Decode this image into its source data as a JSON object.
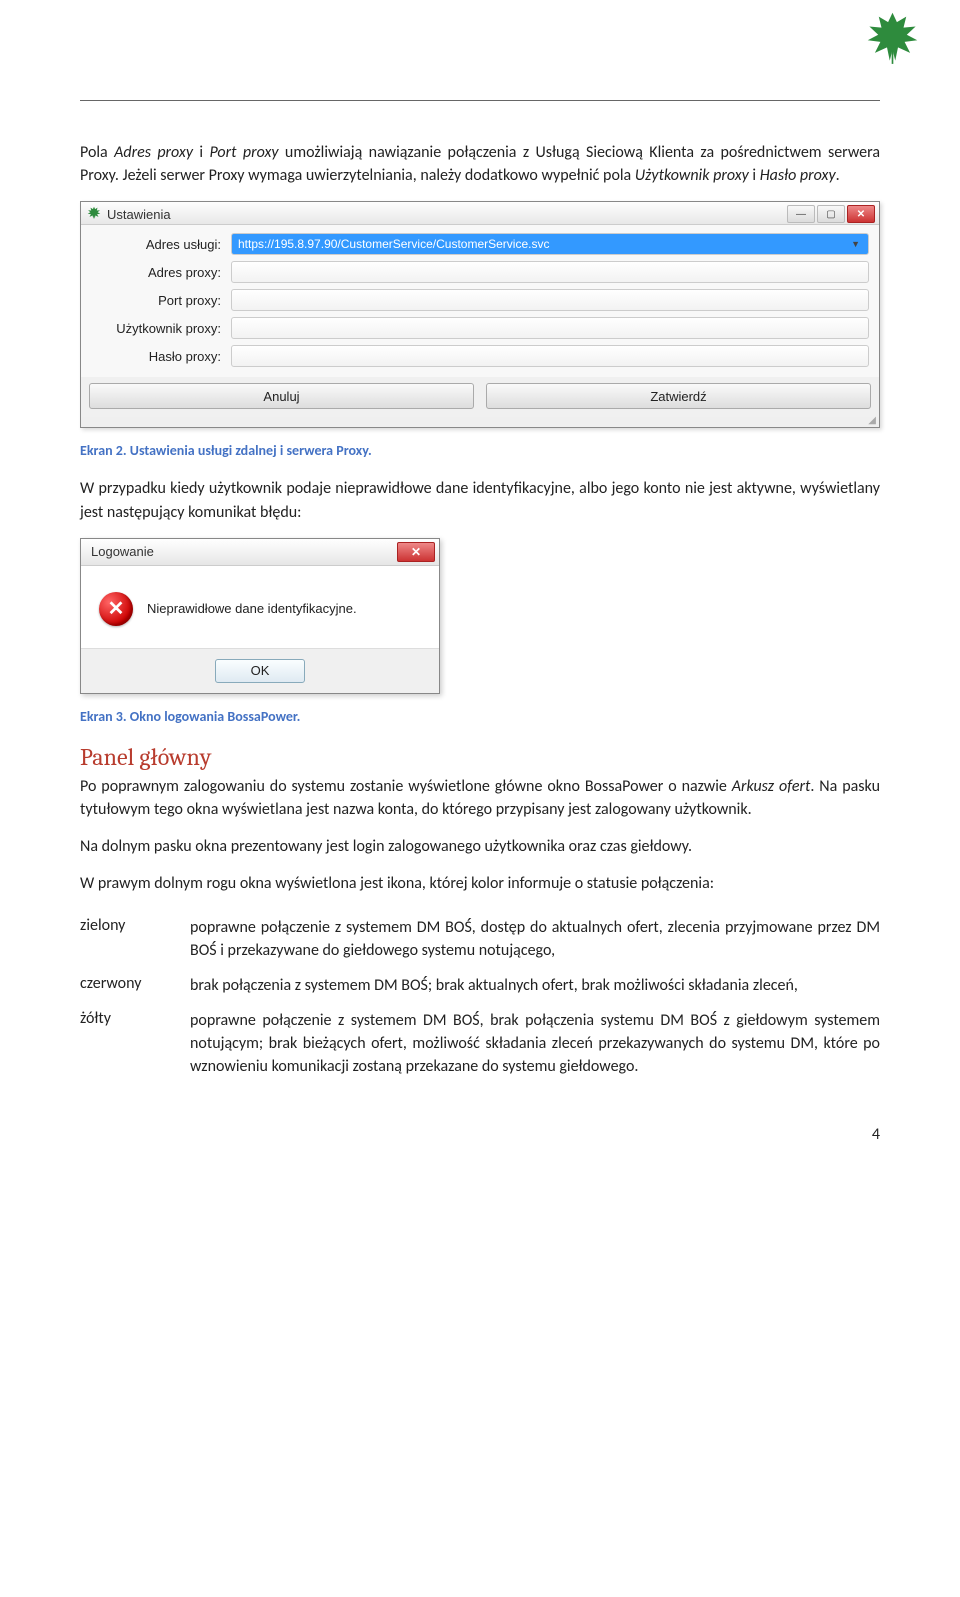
{
  "intro": {
    "p1_a": "Pola ",
    "p1_i1": "Adres proxy",
    "p1_b": " i ",
    "p1_i2": "Port proxy",
    "p1_c": " umożliwiają nawiązanie połączenia z Usługą Sieciową Klienta za pośrednictwem serwera Proxy. Jeżeli serwer Proxy wymaga uwierzytelniania, należy dodatkowo wypełnić pola ",
    "p1_i3": "Użytkownik proxy",
    "p1_d": " i ",
    "p1_i4": "Hasło proxy",
    "p1_e": "."
  },
  "settings": {
    "title": "Ustawienia",
    "fields": [
      {
        "label": "Adres usługi:",
        "value": "https://195.8.97.90/CustomerService/CustomerService.svc",
        "selected": true,
        "dropdown": true
      },
      {
        "label": "Adres proxy:",
        "value": ""
      },
      {
        "label": "Port proxy:",
        "value": ""
      },
      {
        "label": "Użytkownik proxy:",
        "value": ""
      },
      {
        "label": "Hasło proxy:",
        "value": ""
      }
    ],
    "cancel": "Anuluj",
    "confirm": "Zatwierdź"
  },
  "caption1": "Ekran 2. Ustawienia usługi zdalnej i serwera Proxy.",
  "p2": "W przypadku kiedy użytkownik podaje nieprawidłowe dane identyfikacyjne, albo jego konto nie jest aktywne, wyświetlany jest następujący komunikat błędu:",
  "dialog": {
    "title": "Logowanie",
    "message": "Nieprawidłowe dane identyfikacyjne.",
    "ok": "OK"
  },
  "caption2": "Ekran 3. Okno logowania BossaPower.",
  "heading": "Panel główny",
  "p3_a": "Po poprawnym zalogowaniu do systemu zostanie wyświetlone główne okno BossaPower o nazwie ",
  "p3_i": "Arkusz ofert",
  "p3_b": ". Na pasku tytułowym tego okna wyświetlana jest nazwa konta, do którego przypisany jest zalogowany użytkownik.",
  "p4": "Na dolnym pasku okna prezentowany jest login zalogowanego użytkownika oraz czas giełdowy.",
  "p5": "W prawym dolnym rogu okna wyświetlona jest ikona, której kolor informuje o statusie połączenia:",
  "statuses": [
    {
      "key": "zielony",
      "val": "poprawne połączenie z systemem DM BOŚ, dostęp do aktualnych ofert, zlecenia przyjmowane przez DM BOŚ i przekazywane do giełdowego systemu notującego,"
    },
    {
      "key": "czerwony",
      "val": "brak połączenia z systemem DM BOŚ; brak aktualnych ofert, brak możliwości składania zleceń,"
    },
    {
      "key": "żółty",
      "val": "poprawne połączenie z systemem DM BOŚ, brak połączenia systemu DM BOŚ z giełdowym systemem notującym; brak bieżących ofert, możliwość składania zleceń przekazywanych do systemu DM, które po wznowieniu komunikacji zostaną przekazane do systemu giełdowego."
    }
  ],
  "page_number": "4"
}
